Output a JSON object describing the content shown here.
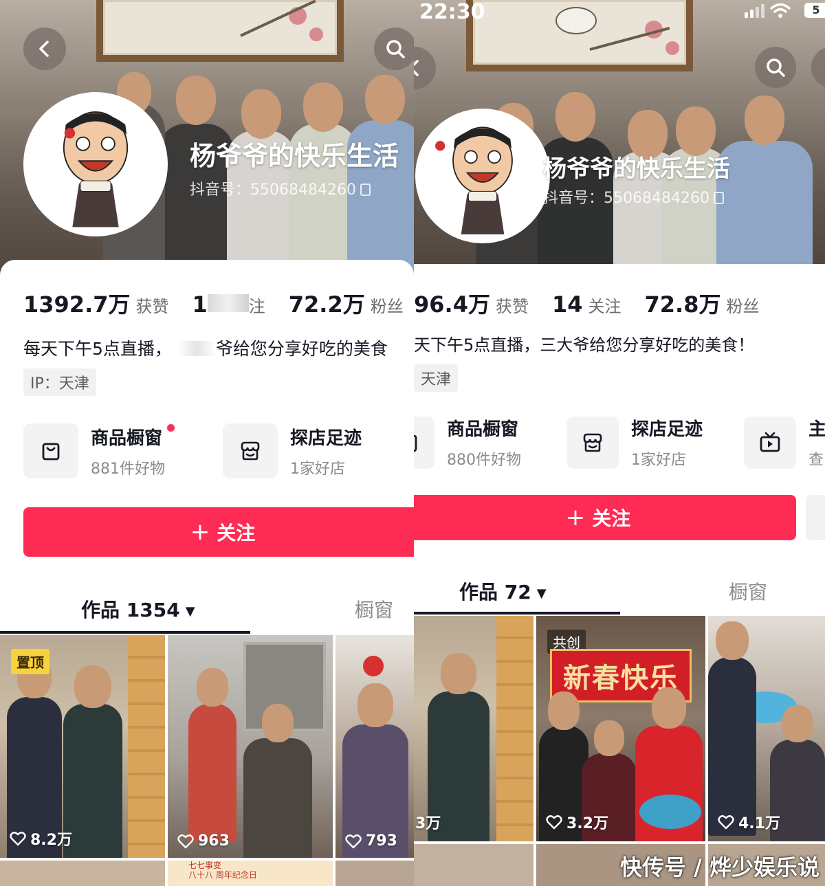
{
  "left": {
    "nickname": "杨爷爷的快乐生活",
    "douyin_id": "抖音号：55068484260",
    "stats": {
      "likes_value": "1392.7万",
      "likes_label": "获赞",
      "following_value": "1",
      "following_label": "注",
      "followers_value": "72.2万",
      "followers_label": "粉丝"
    },
    "bio_part1": "每天下午5点直播，",
    "bio_part2": "爷给您分享好吃的美食",
    "ip": "IP：天津",
    "features": [
      {
        "title": "商品橱窗",
        "subtitle": "881件好物"
      },
      {
        "title": "探店足迹",
        "subtitle": "1家好店"
      }
    ],
    "follow_button": "关注",
    "follow_plus": "+",
    "tabs": {
      "works": "作品 1354",
      "caret": "▼",
      "showcase": "橱窗"
    },
    "videos": [
      {
        "badge": "置顶",
        "likes": "8.2万"
      },
      {
        "likes": "963"
      },
      {
        "likes": "793"
      }
    ],
    "bottom_text": [
      "七七事变",
      "八十八 周年纪念日"
    ]
  },
  "right": {
    "status": {
      "time": "22:30",
      "battery": "5"
    },
    "nickname": "杨爷爷的快乐生活",
    "douyin_id": "抖音号：55068484260",
    "stats": {
      "likes_value": "96.4万",
      "likes_label": "获赞",
      "following_value": "14",
      "following_label": "关注",
      "followers_value": "72.8万",
      "followers_label": "粉丝"
    },
    "bio": "天下午5点直播，三大爷给您分享好吃的美食！",
    "ip": "天津",
    "features": [
      {
        "title": "商品橱窗",
        "subtitle": "880件好物"
      },
      {
        "title": "探店足迹",
        "subtitle": "1家好店"
      },
      {
        "title": "主",
        "subtitle": "查"
      }
    ],
    "follow_button": "关注",
    "follow_plus": "+",
    "tabs": {
      "works": "作品 72",
      "caret": "▼",
      "showcase": "橱窗"
    },
    "videos": [
      {
        "likes": "3万"
      },
      {
        "badge": "共创",
        "banner": "新春快乐",
        "likes": "3.2万"
      },
      {
        "likes": "4.1万"
      }
    ]
  },
  "watermark": "快传号 / 烨少娱乐说",
  "colors": {
    "accent": "#fe2c55",
    "pin_badge": "#f7d23e"
  }
}
